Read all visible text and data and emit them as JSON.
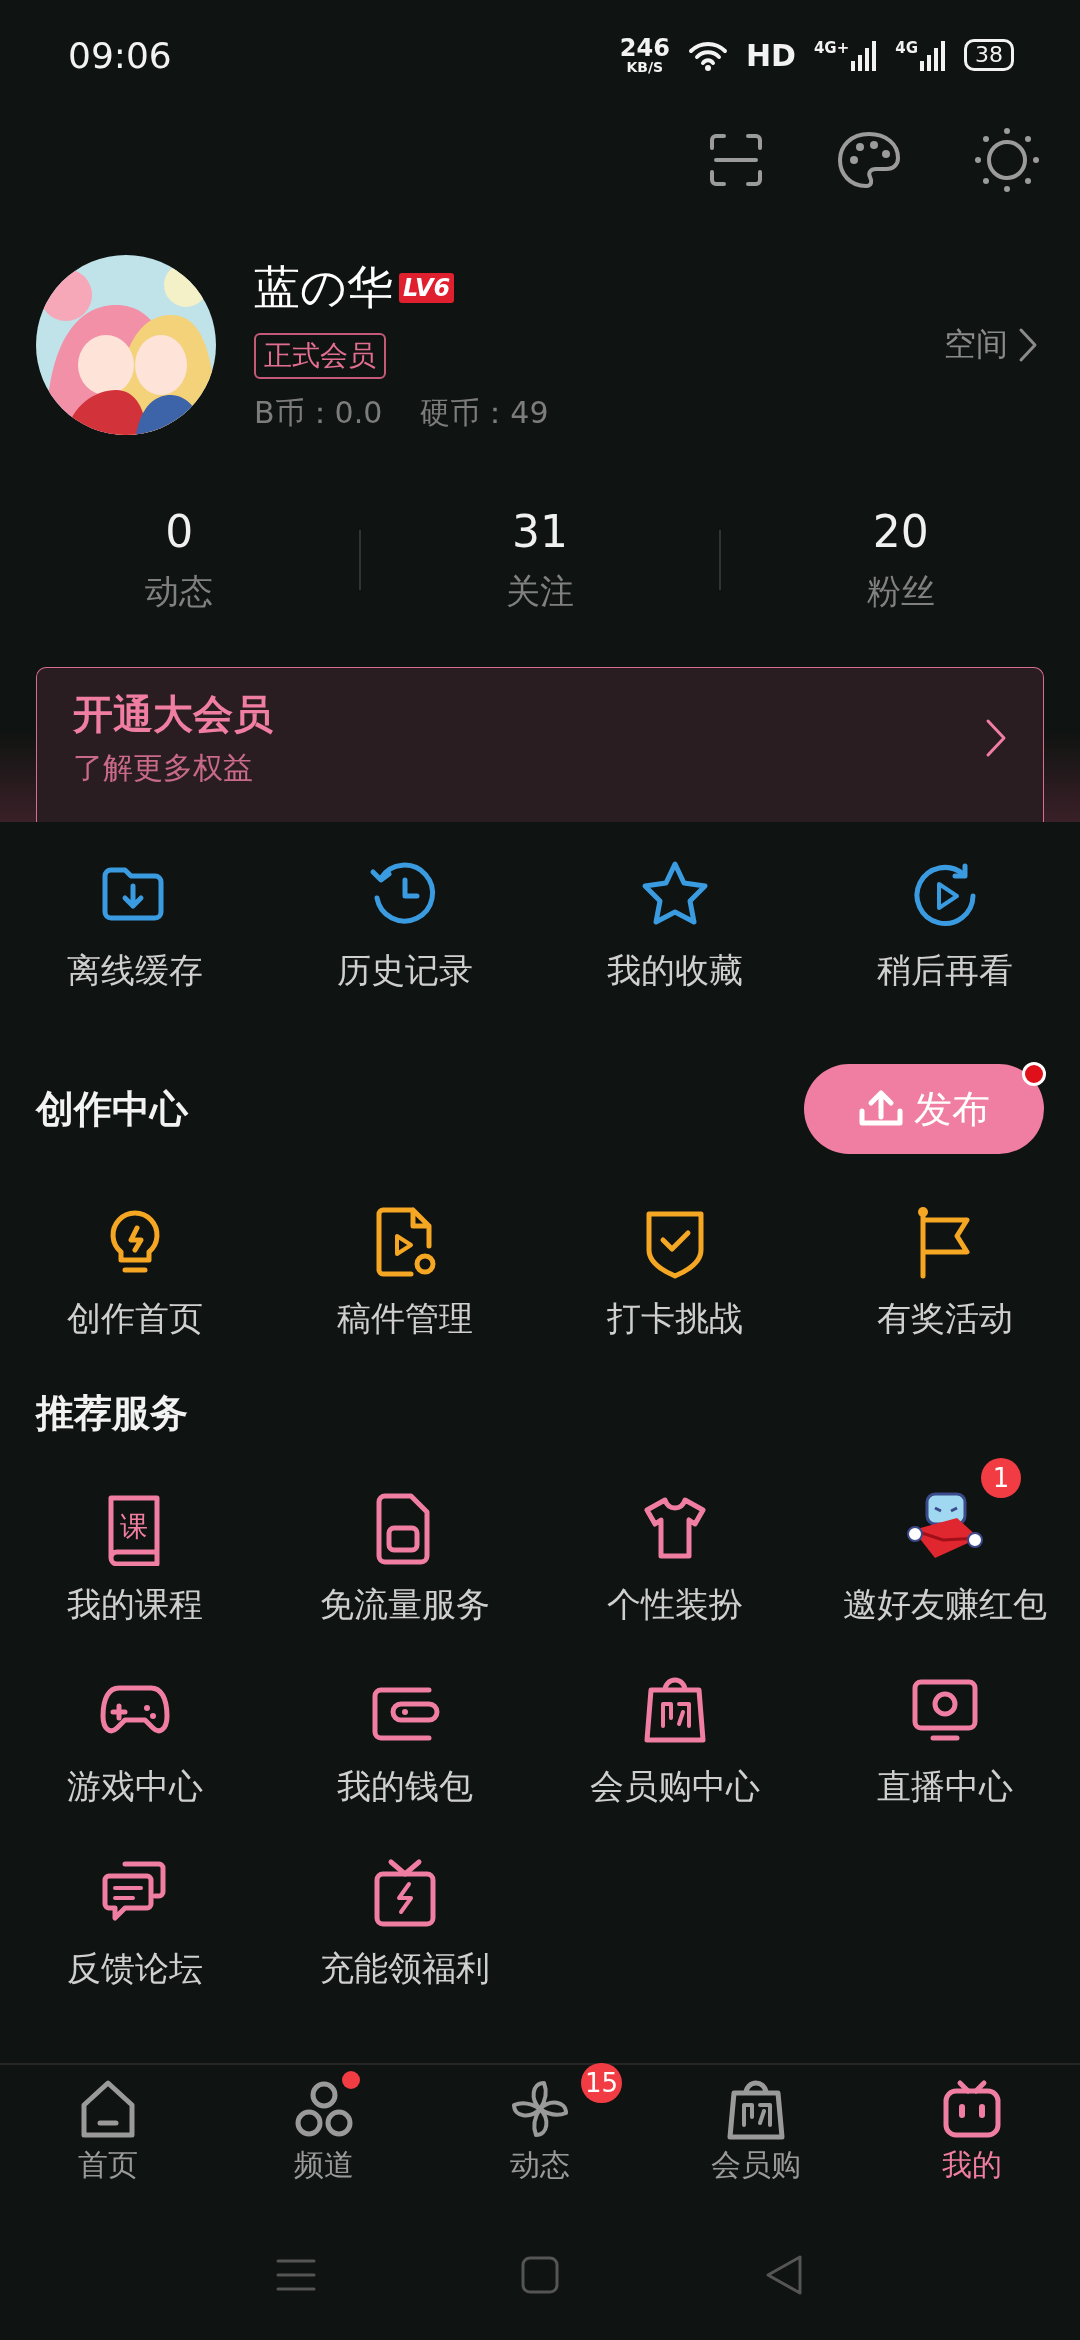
{
  "status_bar": {
    "time": "09:06",
    "net_speed": "246",
    "net_unit": "KB/S",
    "hd": "HD",
    "sim_1": "4G+",
    "sim_2": "4G",
    "battery": "38"
  },
  "profile": {
    "name": "蓝の华",
    "level": "LV6",
    "member_badge": "正式会员",
    "b_coins": "B币：0.0",
    "coins": "硬币：49",
    "space_link": "空间"
  },
  "stats": [
    {
      "value": "0",
      "label": "动态"
    },
    {
      "value": "31",
      "label": "关注"
    },
    {
      "value": "20",
      "label": "粉丝"
    }
  ],
  "vip_banner": {
    "title": "开通大会员",
    "subtitle": "了解更多权益"
  },
  "quick_actions": [
    {
      "label": "离线缓存"
    },
    {
      "label": "历史记录"
    },
    {
      "label": "我的收藏"
    },
    {
      "label": "稍后再看"
    }
  ],
  "creator_center": {
    "title": "创作中心",
    "publish_button": {
      "label": "发布",
      "dot": true
    },
    "items": [
      {
        "label": "创作首页"
      },
      {
        "label": "稿件管理"
      },
      {
        "label": "打卡挑战"
      },
      {
        "label": "有奖活动"
      }
    ]
  },
  "services": {
    "title": "推荐服务",
    "items": [
      {
        "label": "我的课程",
        "icon_text": "课"
      },
      {
        "label": "免流量服务"
      },
      {
        "label": "个性装扮"
      },
      {
        "label": "邀好友赚红包",
        "badge": "1"
      },
      {
        "label": "游戏中心"
      },
      {
        "label": "我的钱包"
      },
      {
        "label": "会员购中心"
      },
      {
        "label": "直播中心"
      },
      {
        "label": "反馈论坛"
      },
      {
        "label": "充能领福利"
      }
    ]
  },
  "bottom_nav": [
    {
      "label": "首页",
      "selected": false
    },
    {
      "label": "频道",
      "selected": false,
      "dot": true
    },
    {
      "label": "动态",
      "selected": false,
      "badge": "15"
    },
    {
      "label": "会员购",
      "selected": false
    },
    {
      "label": "我的",
      "selected": true
    }
  ]
}
